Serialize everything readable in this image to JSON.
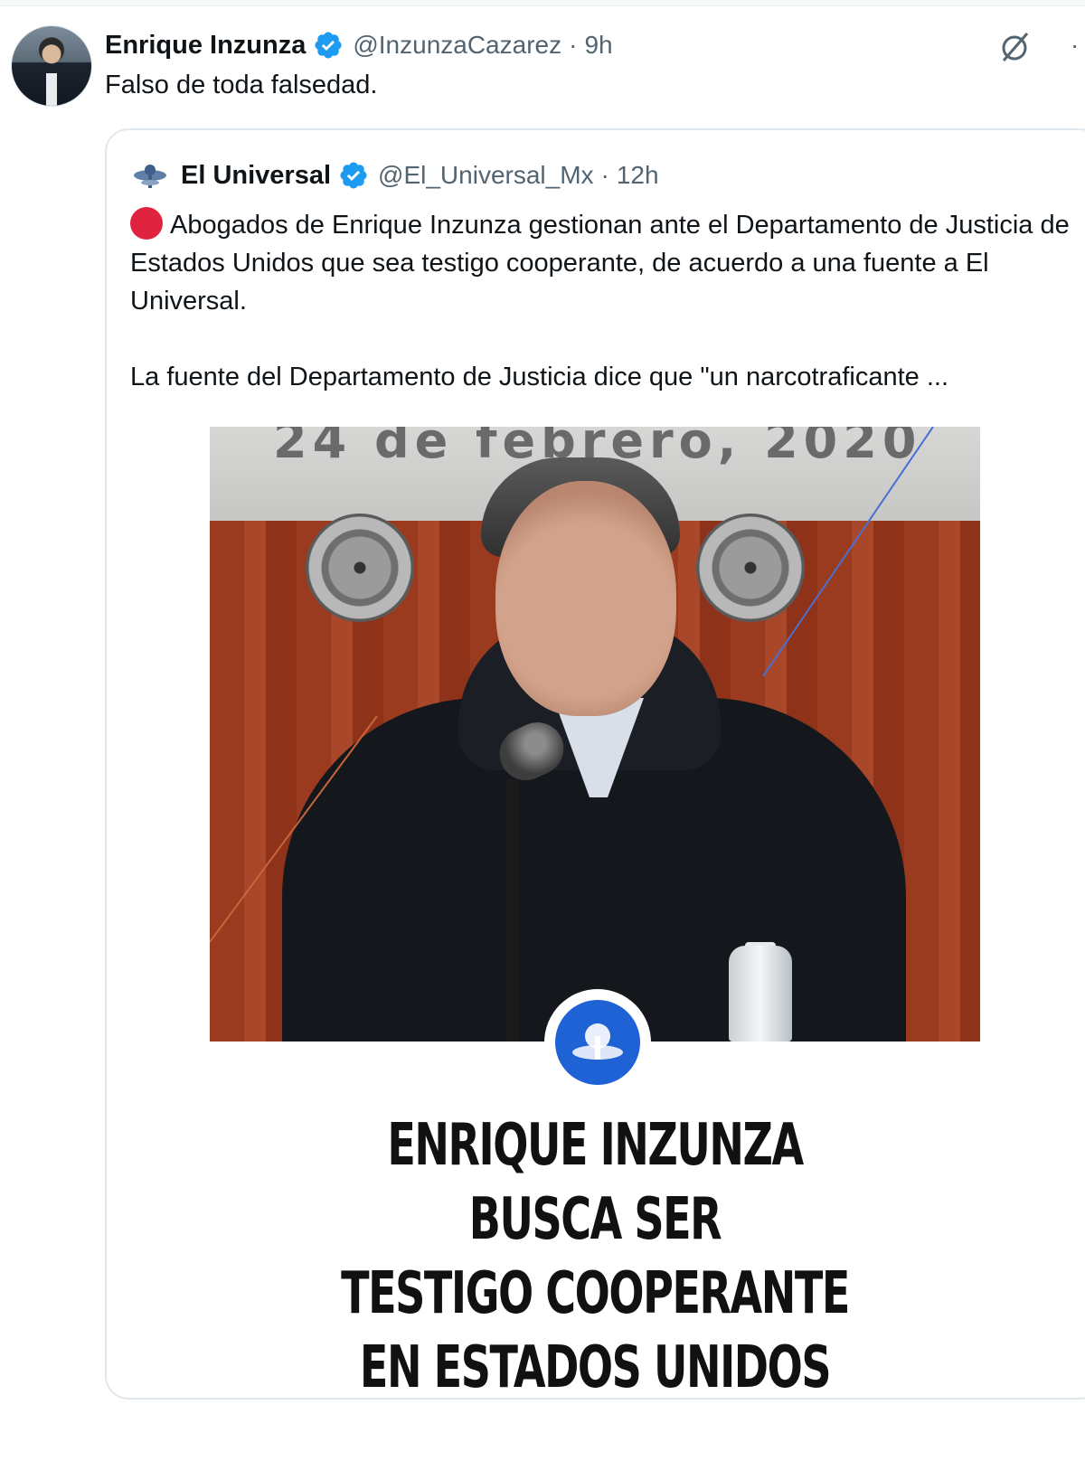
{
  "outer_tweet": {
    "author_name": "Enrique Inzunza",
    "handle": "@InzunzaCazarez",
    "separator": "·",
    "time": "9h",
    "text": "Falso de toda falsedad."
  },
  "quoted_tweet": {
    "author_name": "El Universal",
    "handle": "@El_Universal_Mx",
    "separator": "·",
    "time": "12h",
    "paragraph_1": "Abogados de Enrique Inzunza gestionan ante el Departamento de Justicia de Estados Unidos que sea testigo cooperante, de acuerdo a una fuente a El Universal.",
    "paragraph_2": "La fuente del Departamento de Justicia dice que \"un narcotraficante ...",
    "image": {
      "banner_text": "24 de febrero, 2020",
      "headline_lines": [
        "ENRIQUE INZUNZA BUSCA SER",
        "TESTIGO COOPERANTE",
        "EN ESTADOS UNIDOS"
      ]
    }
  },
  "icons": {
    "verified": "verified-badge-icon",
    "grok": "grok-icon",
    "more": "more-icon",
    "alert": "red-circle-icon"
  },
  "colors": {
    "verified_blue": "#1d9bf0",
    "handle_gray": "#536471",
    "alert_red": "#e0243f",
    "emblem_blue": "#1e62d6"
  }
}
